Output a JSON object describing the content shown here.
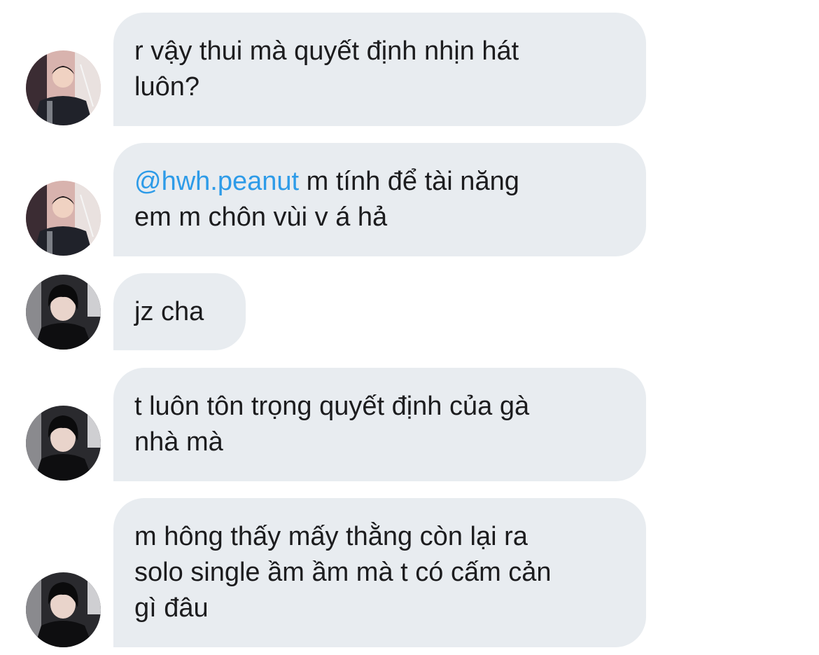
{
  "colors": {
    "bubble_bg": "#e8ecf0",
    "text": "#1c1c1e",
    "mention": "#2d9be8"
  },
  "messages": [
    {
      "avatar": "avatar-user-a",
      "lines": [
        "r vậy thui mà quyết định nhịn hát",
        "luôn?"
      ]
    },
    {
      "avatar": "avatar-user-a",
      "mention": "@hwh.peanut",
      "lines": [
        " m tính để tài năng",
        "em m chôn vùi v á hả"
      ]
    },
    {
      "avatar": "avatar-user-b",
      "lines": [
        "jz cha"
      ]
    },
    {
      "avatar": "avatar-user-b",
      "lines": [
        "t luôn tôn trọng quyết định của gà",
        "nhà mà"
      ]
    },
    {
      "avatar": "avatar-user-b",
      "lines": [
        "m hông thấy mấy thằng còn lại ra",
        "solo single ầm ầm mà t có cấm cản",
        "gì đâu"
      ]
    }
  ]
}
